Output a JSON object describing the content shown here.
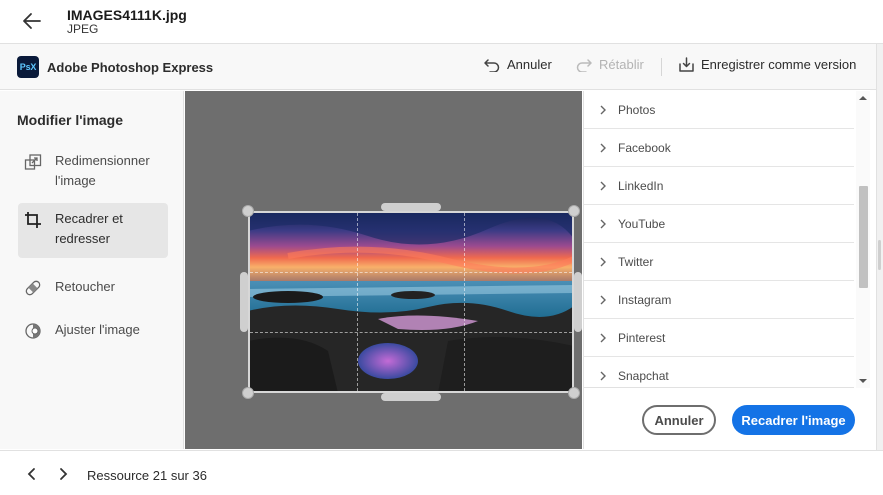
{
  "file": {
    "name": "IMAGES4111K.jpg",
    "type": "JPEG"
  },
  "app": {
    "logo_text": "PsX",
    "name": "Adobe Photoshop Express",
    "undo_label": "Annuler",
    "redo_label": "Rétablir",
    "save_version_label": "Enregistrer comme version"
  },
  "left_panel": {
    "title": "Modifier l'image",
    "tools": [
      {
        "label": "Redimensionner l'image",
        "icon": "resize-icon"
      },
      {
        "label": "Recadrer et redresser",
        "icon": "crop-icon",
        "selected": true
      },
      {
        "label": "Retoucher",
        "icon": "bandage-icon"
      },
      {
        "label": "Ajuster l'image",
        "icon": "adjust-icon"
      }
    ]
  },
  "presets": [
    "Photos",
    "Facebook",
    "LinkedIn",
    "YouTube",
    "Twitter",
    "Instagram",
    "Pinterest",
    "Snapchat"
  ],
  "right_panel": {
    "cancel_label": "Annuler",
    "crop_label": "Recadrer l'image"
  },
  "bottom": {
    "resource_text": "Ressource 21 sur 36"
  },
  "colors": {
    "accent": "#1473e6",
    "canvas_bg": "#6e6e6e",
    "panel_bg": "#f8f8f8"
  }
}
